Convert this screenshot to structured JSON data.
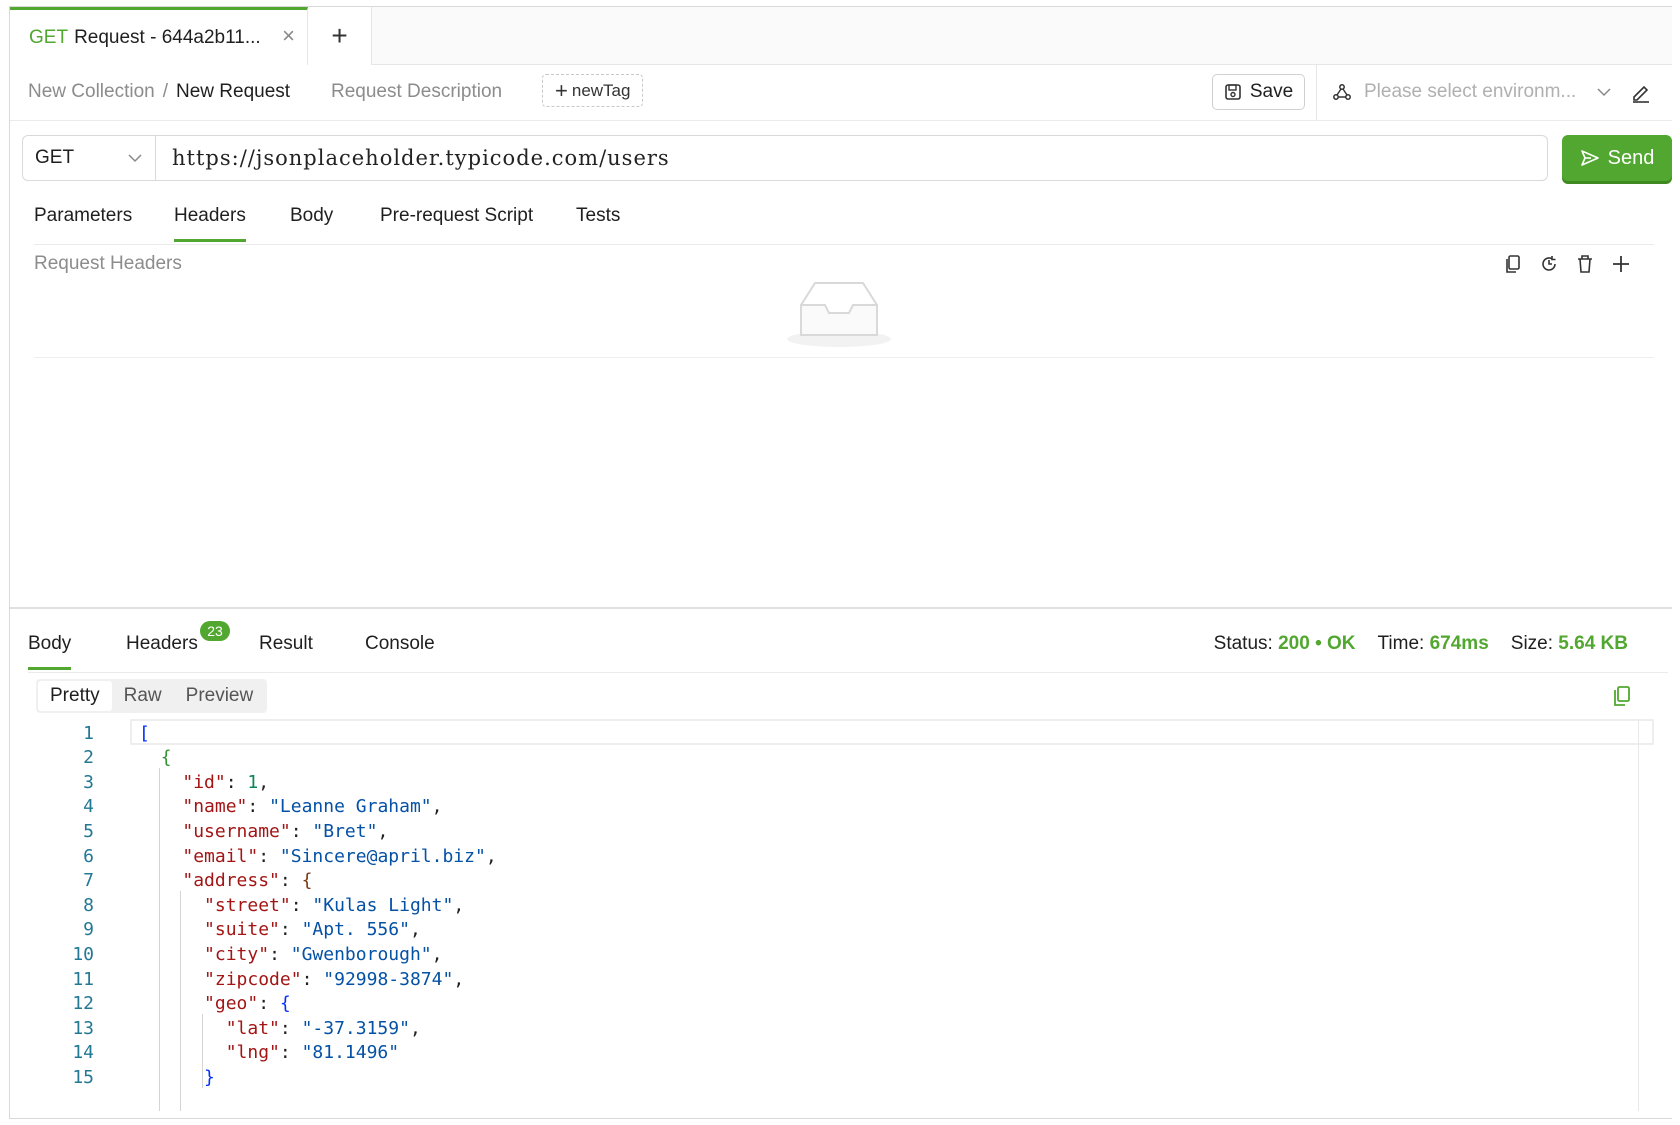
{
  "tab": {
    "method": "GET",
    "title": "Request - 644a2b11...",
    "close": "×",
    "add": "+"
  },
  "breadcrumb": {
    "collection": "New Collection",
    "separator": "/",
    "request": "New Request"
  },
  "request_description": "Request Description",
  "new_tag": {
    "plus": "+",
    "label": "newTag"
  },
  "save_label": "Save",
  "environment": {
    "placeholder": "Please select environm..."
  },
  "method": "GET",
  "url": "https://jsonplaceholder.typicode.com/users",
  "send_label": "Send",
  "request_tabs": [
    "Parameters",
    "Headers",
    "Body",
    "Pre-request Script",
    "Tests"
  ],
  "request_tabs_active": "Headers",
  "request_headers_label": "Request Headers",
  "response_tabs": [
    "Body",
    "Headers",
    "Result",
    "Console"
  ],
  "response_headers_count": "23",
  "status": {
    "status_label": "Status:",
    "status_value": "200 • OK",
    "time_label": "Time:",
    "time_value": "674ms",
    "size_label": "Size:",
    "size_value": "5.64 KB"
  },
  "view_tabs": [
    "Pretty",
    "Raw",
    "Preview"
  ],
  "code_lines": [
    "[",
    "  {",
    "    \"id\": 1,",
    "    \"name\": \"Leanne Graham\",",
    "    \"username\": \"Bret\",",
    "    \"email\": \"Sincere@april.biz\",",
    "    \"address\": {",
    "      \"street\": \"Kulas Light\",",
    "      \"suite\": \"Apt. 556\",",
    "      \"city\": \"Gwenborough\",",
    "      \"zipcode\": \"92998-3874\",",
    "      \"geo\": {",
    "        \"lat\": \"-37.3159\",",
    "        \"lng\": \"81.1496\"",
    "      }"
  ],
  "colors": {
    "accent": "#52a730",
    "key": "#a31515",
    "string": "#0451a5",
    "number": "#098658",
    "line_number": "#237893"
  }
}
